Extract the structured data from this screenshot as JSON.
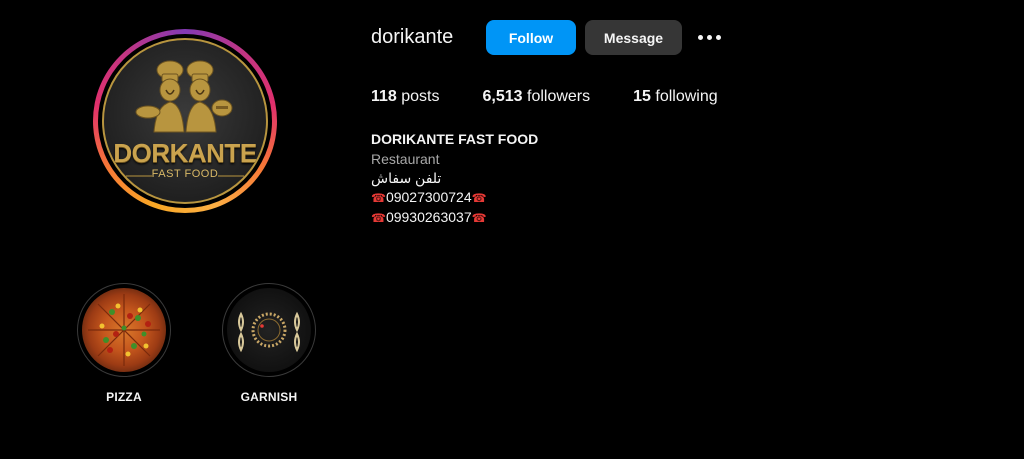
{
  "profile": {
    "username": "dorikante",
    "follow_label": "Follow",
    "message_label": "Message",
    "avatar_logo_main": "DORKANTE",
    "avatar_logo_sub": "FAST FOOD"
  },
  "stats": {
    "posts_count": "118",
    "posts_label": " posts",
    "followers_count": "6,513",
    "followers_label": " followers",
    "following_count": "15",
    "following_label": " following"
  },
  "bio": {
    "name": "DORIKANTE FAST FOOD",
    "category": "Restaurant",
    "line1": "تلفن سفاش",
    "phone1": "09027300724",
    "phone2": "09930263037",
    "phone_icon": "☎"
  },
  "highlights": [
    {
      "label": "PIZZA",
      "icon": "pizza-thumbnail"
    },
    {
      "label": "GARNISH",
      "icon": "garnish-thumbnail"
    }
  ],
  "colors": {
    "follow_button": "#0095f6",
    "message_button": "#363636",
    "logo_gold": "#caa34e",
    "phone_icon": "#e53935"
  }
}
